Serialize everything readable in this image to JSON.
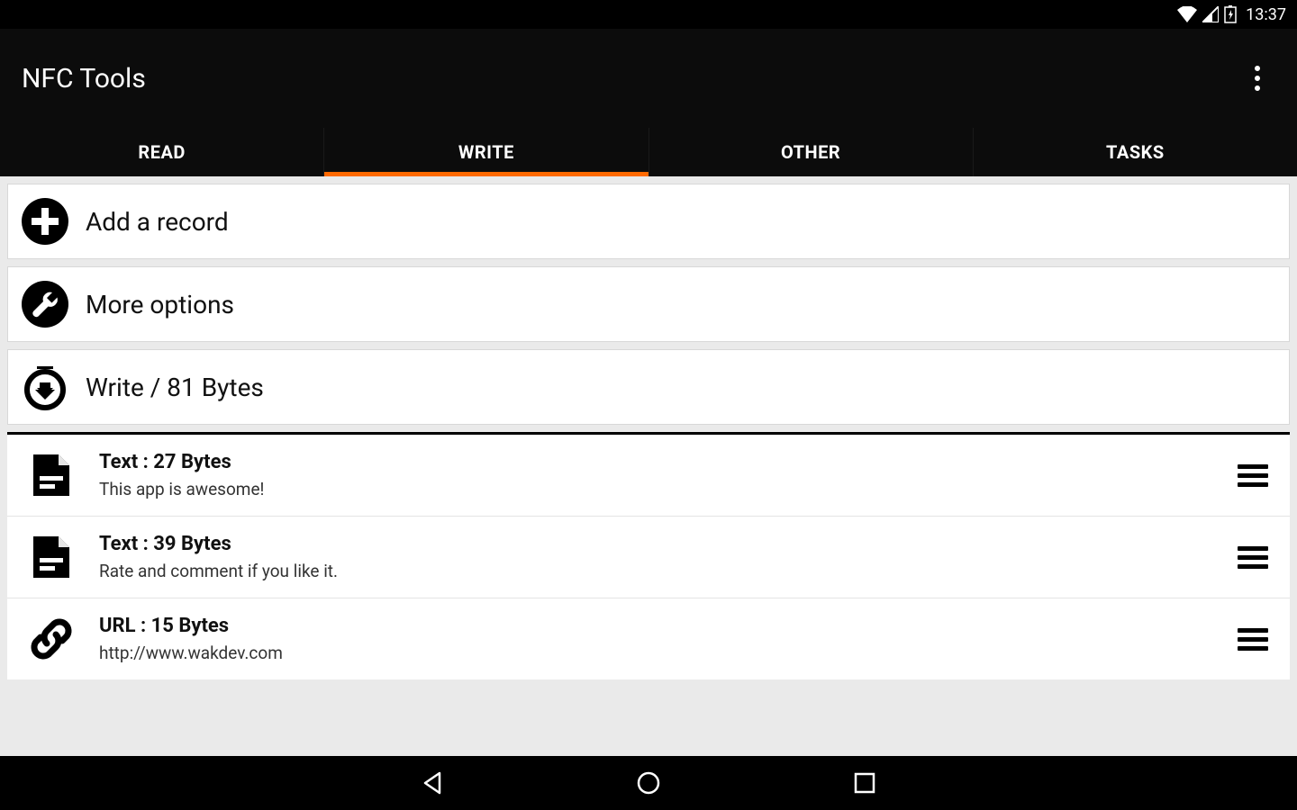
{
  "status": {
    "time": "13:37"
  },
  "app": {
    "title": "NFC Tools"
  },
  "tabs": [
    {
      "label": "READ",
      "active": false
    },
    {
      "label": "WRITE",
      "active": true
    },
    {
      "label": "OTHER",
      "active": false
    },
    {
      "label": "TASKS",
      "active": false
    }
  ],
  "actions": {
    "add": "Add a record",
    "more": "More options",
    "write": "Write / 81 Bytes"
  },
  "records": [
    {
      "title": "Text : 27 Bytes",
      "sub": "This app is awesome!",
      "icon": "text-file-icon"
    },
    {
      "title": "Text : 39 Bytes",
      "sub": "Rate and comment if you like it.",
      "icon": "text-file-icon"
    },
    {
      "title": "URL : 15 Bytes",
      "sub": "http://www.wakdev.com",
      "icon": "link-icon"
    }
  ],
  "colors": {
    "accent": "#ff6a00"
  }
}
